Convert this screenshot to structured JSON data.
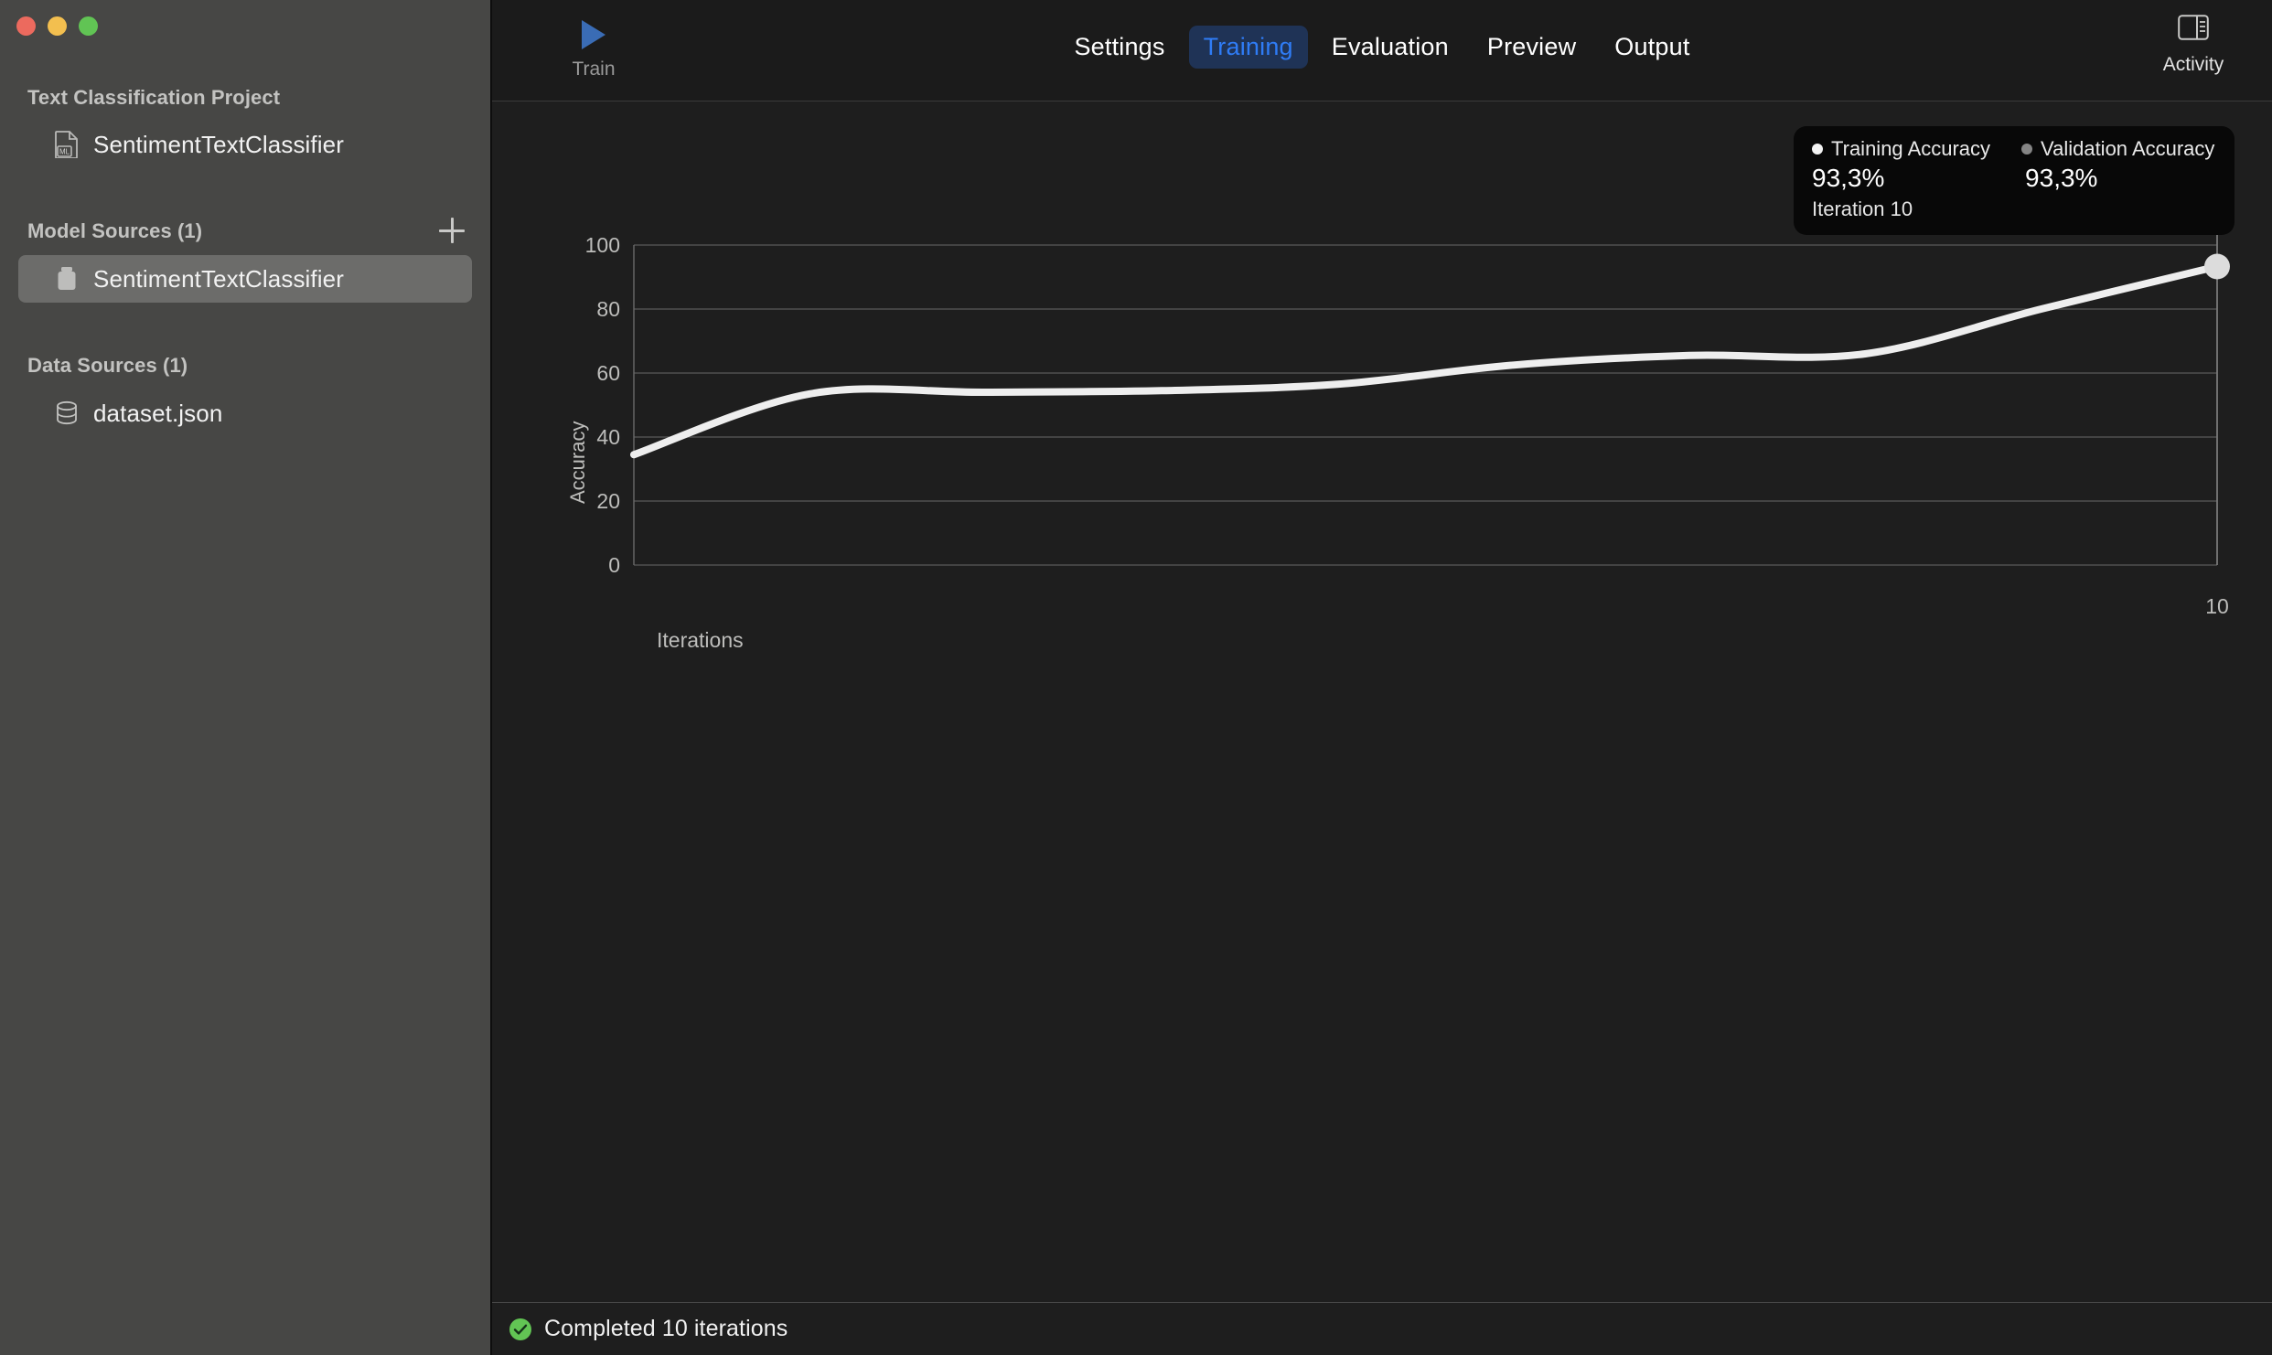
{
  "window": {
    "traffic_lights": [
      {
        "name": "close",
        "color": "#ec6a5e"
      },
      {
        "name": "minimize",
        "color": "#f3bf4f"
      },
      {
        "name": "zoom",
        "color": "#61c454"
      }
    ]
  },
  "sidebar": {
    "project_header": "Text Classification Project",
    "project_item": {
      "label": "SentimentTextClassifier",
      "icon": "ml-document-icon"
    },
    "model_sources_header": "Model Sources (1)",
    "add_button_icon": "plus-icon",
    "model_item": {
      "label": "SentimentTextClassifier",
      "icon": "box-icon",
      "selected": true
    },
    "data_sources_header": "Data Sources (1)",
    "data_item": {
      "label": "dataset.json",
      "icon": "database-icon"
    }
  },
  "toolbar": {
    "train_label": "Train",
    "train_icon": "play-icon",
    "train_icon_color": "#3a6cb5",
    "tabs": [
      {
        "label": "Settings",
        "active": false
      },
      {
        "label": "Training",
        "active": true
      },
      {
        "label": "Evaluation",
        "active": false
      },
      {
        "label": "Preview",
        "active": false
      },
      {
        "label": "Output",
        "active": false
      }
    ],
    "activity_label": "Activity",
    "activity_icon": "sidebar-panel-icon",
    "active_tab_bg": "#1f3356",
    "active_tab_fg": "#2f7cf6"
  },
  "tooltip": {
    "training": {
      "name": "Training Accuracy",
      "value": "93,3%",
      "dot_color": "#f3f3f3"
    },
    "validation": {
      "name": "Validation Accuracy",
      "value": "93,3%",
      "dot_color": "#858585"
    },
    "iteration": "Iteration 10"
  },
  "statusbar": {
    "icon": "check-circle-icon",
    "icon_color": "#62c554",
    "text": "Completed 10 iterations"
  },
  "chart_data": {
    "type": "line",
    "title": "",
    "xlabel": "Iterations",
    "ylabel": "Accuracy",
    "xlim": [
      1,
      10
    ],
    "ylim": [
      0,
      100
    ],
    "xticks": [
      10
    ],
    "xtick_labels": [
      "10"
    ],
    "yticks": [
      0,
      20,
      40,
      60,
      80,
      100
    ],
    "ytick_labels": [
      "0",
      "20",
      "40",
      "60",
      "80",
      "100"
    ],
    "grid": true,
    "grid_color": "#5a5a5a",
    "legend_position": "top-right",
    "x": [
      1,
      2,
      3,
      4,
      5,
      6,
      7,
      8,
      9,
      10
    ],
    "series": [
      {
        "name": "Training Accuracy",
        "color": "#eeeeee",
        "values": [
          34.5,
          53.5,
          54.0,
          54.5,
          56.5,
          62.5,
          65.5,
          66.0,
          80.0,
          93.3
        ],
        "marker_at": {
          "x": 10,
          "y": 93.3,
          "color": "#dcdcdc"
        }
      }
    ],
    "highlight_iteration": 10
  }
}
